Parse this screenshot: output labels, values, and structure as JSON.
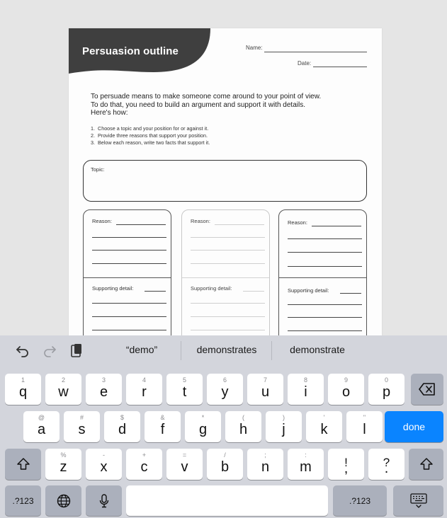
{
  "worksheet": {
    "title": "Persuasion outline",
    "name_label": "Name:",
    "date_label": "Date:",
    "intro_lines": [
      "To persuade means to make someone come around to your point of view.",
      "To do that, you need to build an argument and support it with details.",
      "Here's how:"
    ],
    "steps": [
      {
        "num": "1.",
        "text": "Choose a topic and your position for or against it."
      },
      {
        "num": "2.",
        "text": "Provide three reasons that support your position."
      },
      {
        "num": "3.",
        "text": "Below each reason, write two facts that support it."
      }
    ],
    "topic_label": "Topic:",
    "reason_label": "Reason:",
    "detail_label": "Supporting detail:"
  },
  "keyboard": {
    "suggestions": [
      "“demo”",
      "demonstrates",
      "demonstrate"
    ],
    "icons": {
      "undo": "undo-icon",
      "redo": "redo-icon",
      "paste": "clipboard-icon"
    },
    "row1": [
      {
        "alt": "1",
        "main": "q"
      },
      {
        "alt": "2",
        "main": "w"
      },
      {
        "alt": "3",
        "main": "e"
      },
      {
        "alt": "4",
        "main": "r"
      },
      {
        "alt": "5",
        "main": "t"
      },
      {
        "alt": "6",
        "main": "y"
      },
      {
        "alt": "7",
        "main": "u"
      },
      {
        "alt": "8",
        "main": "i"
      },
      {
        "alt": "9",
        "main": "o"
      },
      {
        "alt": "0",
        "main": "p"
      }
    ],
    "row2": [
      {
        "alt": "@",
        "main": "a"
      },
      {
        "alt": "#",
        "main": "s"
      },
      {
        "alt": "$",
        "main": "d"
      },
      {
        "alt": "&",
        "main": "f"
      },
      {
        "alt": "*",
        "main": "g"
      },
      {
        "alt": "(",
        "main": "h"
      },
      {
        "alt": ")",
        "main": "j"
      },
      {
        "alt": "'",
        "main": "k"
      },
      {
        "alt": "\"",
        "main": "l"
      }
    ],
    "row3": [
      {
        "alt": "%",
        "main": "z"
      },
      {
        "alt": "-",
        "main": "x"
      },
      {
        "alt": "+",
        "main": "c"
      },
      {
        "alt": "=",
        "main": "v"
      },
      {
        "alt": "/",
        "main": "b"
      },
      {
        "alt": ";",
        "main": "n"
      },
      {
        "alt": ":",
        "main": "m"
      },
      {
        "alt": "!",
        "main": ","
      },
      {
        "alt": "?",
        "main": "."
      }
    ],
    "done_label": "done",
    "numbers_label": ".?123",
    "accent_color": "#0a84ff"
  }
}
